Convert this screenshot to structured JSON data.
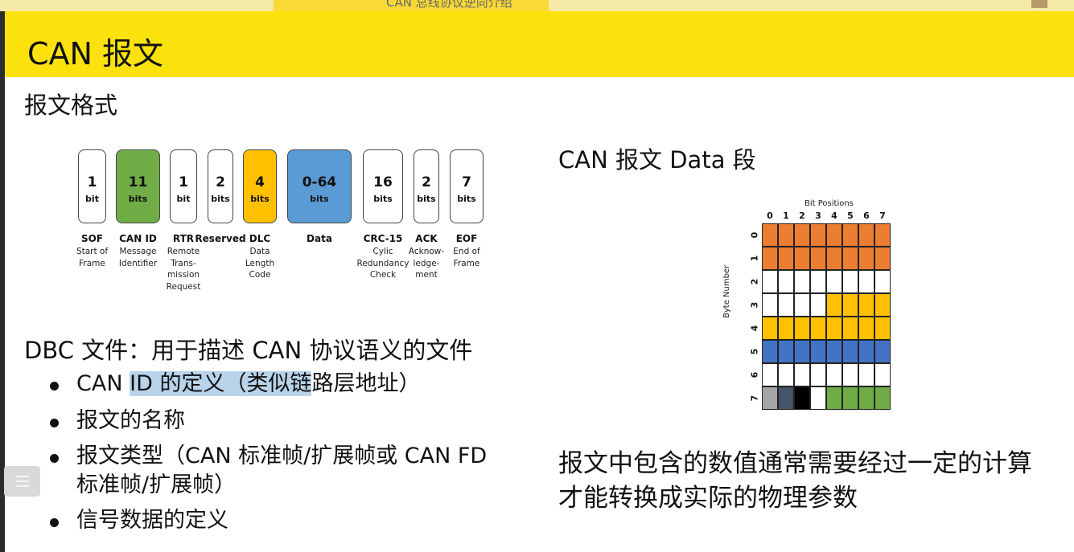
{
  "header": {
    "top_tab_text": "CAN 总线协议逆向介绍",
    "title": "CAN 报文"
  },
  "section_format": "报文格式",
  "can_frame": {
    "fields": [
      {
        "num": "1",
        "unit": "bit",
        "name": "SOF",
        "desc": [
          "Start of",
          "Frame"
        ],
        "color": "#ffffff"
      },
      {
        "num": "11",
        "unit": "bits",
        "name": "CAN ID",
        "desc": [
          "Message",
          "Identifier"
        ],
        "color": "#70ad47"
      },
      {
        "num": "1",
        "unit": "bit",
        "name": "RTR",
        "desc": [
          "Remote",
          "Trans-",
          "mission",
          "Request"
        ],
        "color": "#ffffff"
      },
      {
        "num": "2",
        "unit": "bits",
        "name": "Reserved",
        "desc": [],
        "color": "#ffffff"
      },
      {
        "num": "4",
        "unit": "bits",
        "name": "DLC",
        "desc": [
          "Data",
          "Length",
          "Code"
        ],
        "color": "#ffc000"
      },
      {
        "num": "0-64",
        "unit": "bits",
        "name": "Data",
        "desc": [],
        "color": "#5b9bd5"
      },
      {
        "num": "16",
        "unit": "bits",
        "name": "CRC-15",
        "desc": [
          "Cylic",
          "Redundancy",
          "Check"
        ],
        "color": "#ffffff"
      },
      {
        "num": "2",
        "unit": "bits",
        "name": "ACK",
        "desc": [
          "Acknow-",
          "ledge-",
          "ment"
        ],
        "color": "#ffffff"
      },
      {
        "num": "7",
        "unit": "bits",
        "name": "EOF",
        "desc": [
          "End of",
          "Frame"
        ],
        "color": "#ffffff"
      }
    ]
  },
  "dbc": {
    "heading": "DBC 文件：用于描述 CAN 协议语义的文件",
    "bullet1_pre": "CAN ",
    "bullet1_hl": "ID 的定义（类似链",
    "bullet1_post": "路层地址）",
    "bullet2": "报文的名称",
    "bullet3_line1": "报文类型（CAN 标准帧/扩展帧或 CAN FD",
    "bullet3_line2": "标准帧/扩展帧）",
    "bullet4": "信号数据的定义"
  },
  "data_section": {
    "title": "CAN 报文 Data 段",
    "bit_positions_label": "Bit Positions",
    "byte_number_label": "Byte Number",
    "bit_labels": [
      "0",
      "1",
      "2",
      "3",
      "4",
      "5",
      "6",
      "7"
    ],
    "byte_labels": [
      "0",
      "1",
      "2",
      "3",
      "4",
      "5",
      "6",
      "7"
    ],
    "cell_colors": [
      [
        "#ed7d31",
        "#ed7d31",
        "#ed7d31",
        "#ed7d31",
        "#ed7d31",
        "#ed7d31",
        "#ed7d31",
        "#ed7d31"
      ],
      [
        "#ed7d31",
        "#ed7d31",
        "#ed7d31",
        "#ed7d31",
        "#ed7d31",
        "#ed7d31",
        "#ed7d31",
        "#ed7d31"
      ],
      [
        "#ffffff",
        "#ffffff",
        "#ffffff",
        "#ffffff",
        "#ffffff",
        "#ffffff",
        "#ffffff",
        "#ffffff"
      ],
      [
        "#ffffff",
        "#ffffff",
        "#ffffff",
        "#ffffff",
        "#ffc000",
        "#ffc000",
        "#ffc000",
        "#ffc000"
      ],
      [
        "#ffc000",
        "#ffc000",
        "#ffc000",
        "#ffc000",
        "#ffc000",
        "#ffc000",
        "#ffc000",
        "#ffc000"
      ],
      [
        "#4472c4",
        "#4472c4",
        "#4472c4",
        "#4472c4",
        "#4472c4",
        "#4472c4",
        "#4472c4",
        "#4472c4"
      ],
      [
        "#ffffff",
        "#ffffff",
        "#ffffff",
        "#ffffff",
        "#ffffff",
        "#ffffff",
        "#ffffff",
        "#ffffff"
      ],
      [
        "#a5a5a5",
        "#44546a",
        "#000000",
        "#ffffff",
        "#70ad47",
        "#70ad47",
        "#70ad47",
        "#70ad47"
      ]
    ],
    "note_line1": "报文中包含的数值通常需要经过一定的计算",
    "note_line2": "才能转换成实际的物理参数"
  },
  "menu_icon": "menu-icon"
}
